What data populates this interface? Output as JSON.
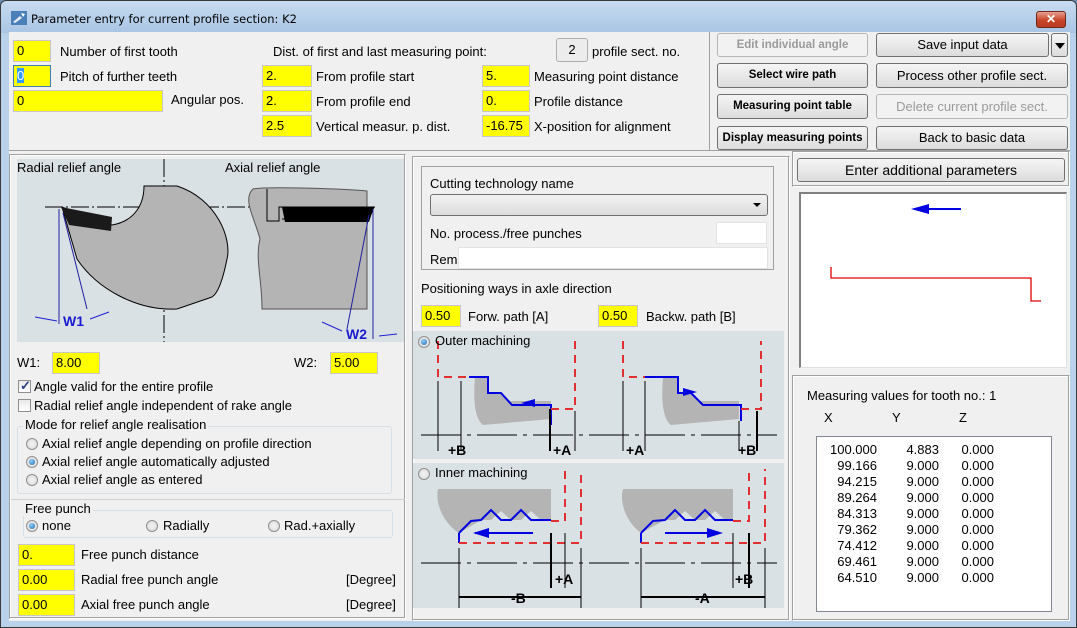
{
  "window": {
    "title": "Parameter entry for current profile section: K2",
    "close_label": "✕"
  },
  "top": {
    "first_tooth": {
      "value": "0",
      "label": "Number of first tooth"
    },
    "pitch": {
      "value": "0",
      "label": "Pitch of further teeth"
    },
    "angular_pos": {
      "value": "0",
      "label": "Angular pos."
    },
    "dist_header": "Dist. of first and last measuring point:",
    "profile_sect_no": {
      "value": "2",
      "label": "profile sect. no."
    },
    "from_start": {
      "value": "2.",
      "label": "From profile start"
    },
    "from_end": {
      "value": "2.",
      "label": "From profile end"
    },
    "vertical_dist": {
      "value": "2.5",
      "label": "Vertical measur. p. dist."
    },
    "measuring_point_distance": {
      "value": "5.",
      "label": "Measuring point distance"
    },
    "profile_distance": {
      "value": "0.",
      "label": "Profile distance"
    },
    "x_position_alignment": {
      "value": "-16.75",
      "label": "X-position for alignment"
    }
  },
  "buttons": {
    "edit_individual_angle": "Edit individual angle",
    "select_wire_path": "Select wire path",
    "measuring_point_table": "Measuring point table",
    "display_measuring_points": "Display measuring points",
    "save_input_data": "Save input data",
    "process_other_profile": "Process other profile sect.",
    "delete_current_profile": "Delete current profile sect.",
    "back_to_basic": "Back to basic data",
    "enter_additional": "Enter additional parameters"
  },
  "relief": {
    "radial_title": "Radial relief angle",
    "axial_title": "Axial relief angle",
    "w1_mark": "W1",
    "w2_mark": "W2",
    "w1": {
      "label": "W1:",
      "value": "8.00"
    },
    "w2": {
      "label": "W2:",
      "value": "5.00"
    },
    "angle_valid_entire": {
      "label": "Angle valid for the entire profile",
      "checked": true
    },
    "radial_independent": {
      "label": "Radial relief angle independent of rake angle",
      "checked": false
    },
    "mode_group_title": "Mode for relief angle realisation",
    "mode_options": [
      {
        "label": "Axial relief angle depending on profile direction",
        "selected": false
      },
      {
        "label": "Axial relief angle automatically adjusted",
        "selected": true
      },
      {
        "label": "Axial relief angle as entered",
        "selected": false
      }
    ]
  },
  "free_punch": {
    "group_title": "Free punch",
    "options": [
      {
        "label": "none",
        "selected": true
      },
      {
        "label": "Radially",
        "selected": false
      },
      {
        "label": "Rad.+axially",
        "selected": false
      }
    ],
    "distance": {
      "value": "0.",
      "label": "Free punch distance"
    },
    "radial_angle": {
      "value": "0.00",
      "label": "Radial free punch angle",
      "unit": "[Degree]"
    },
    "axial_angle": {
      "value": "0.00",
      "label": "Axial free punch angle",
      "unit": "[Degree]"
    }
  },
  "technology": {
    "cutting_name_label": "Cutting technology name",
    "cutting_name_value": "",
    "process_punches_label": "No. process./free punches",
    "process_punches_value": "",
    "rem_label": "Rem.",
    "rem_value": "",
    "positioning_title": "Positioning ways in axle direction",
    "forw_path": {
      "value": "0.50",
      "label": "Forw. path [A]"
    },
    "backw_path": {
      "value": "0.50",
      "label": "Backw. path [B]"
    },
    "outer_machining": {
      "label": "Outer machining",
      "selected": true
    },
    "inner_machining": {
      "label": "Inner machining",
      "selected": false
    },
    "marks": {
      "plusA": "+A",
      "plusB": "+B",
      "minusA": "-A",
      "minusB": "-B"
    }
  },
  "measuring": {
    "title": "Measuring values for tooth no.: 1",
    "columns": [
      "X",
      "Y",
      "Z"
    ],
    "rows": [
      [
        "100.000",
        "4.883",
        "0.000"
      ],
      [
        "99.166",
        "9.000",
        "0.000"
      ],
      [
        "94.215",
        "9.000",
        "0.000"
      ],
      [
        "89.264",
        "9.000",
        "0.000"
      ],
      [
        "84.313",
        "9.000",
        "0.000"
      ],
      [
        "79.362",
        "9.000",
        "0.000"
      ],
      [
        "74.412",
        "9.000",
        "0.000"
      ],
      [
        "69.461",
        "9.000",
        "0.000"
      ],
      [
        "64.510",
        "9.000",
        "0.000"
      ]
    ]
  },
  "colors": {
    "input_highlight": "#ffff00",
    "profile_line": "#e00000",
    "direction_arrow": "#0000ff"
  }
}
